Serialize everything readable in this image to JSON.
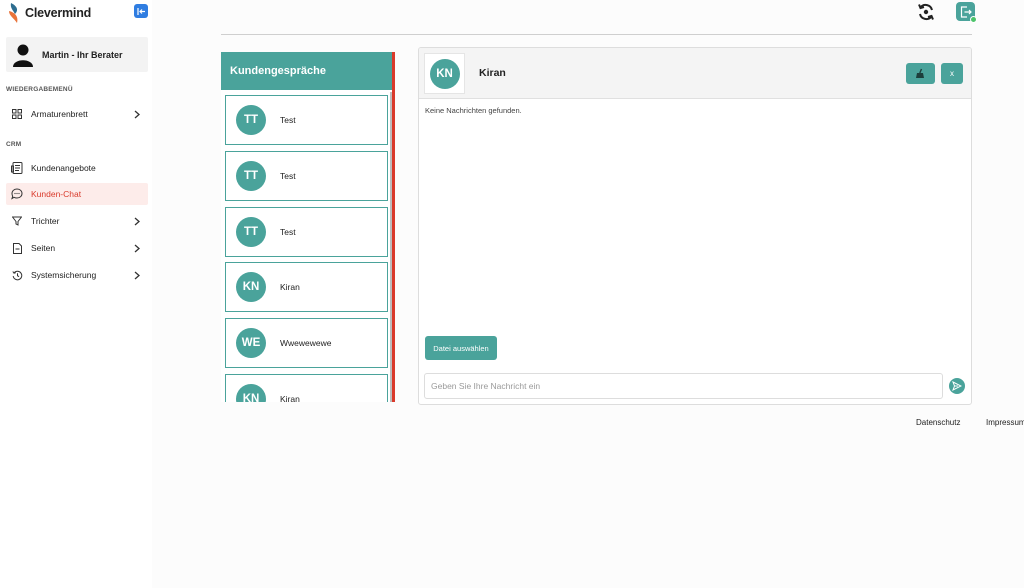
{
  "app": {
    "name": "Clevermind"
  },
  "user": {
    "name": "Martin - Ihr Berater"
  },
  "sidebar": {
    "section_main": "WIEDERGABEMENÜ",
    "dashboard": "Armaturenbrett",
    "section_crm": "CRM",
    "offers": "Kundenangebote",
    "chat": "Kunden-Chat",
    "funnel": "Trichter",
    "pages": "Seiten",
    "backup": "Systemsicherung"
  },
  "conversations": {
    "title": "Kundengespräche",
    "items": [
      {
        "initials": "TT",
        "name": "Test"
      },
      {
        "initials": "TT",
        "name": "Test"
      },
      {
        "initials": "TT",
        "name": "Test"
      },
      {
        "initials": "KN",
        "name": "Kiran"
      },
      {
        "initials": "WE",
        "name": "Wwewewewe"
      },
      {
        "initials": "KN",
        "name": "Kiran"
      }
    ]
  },
  "chat": {
    "initials": "KN",
    "name": "Kiran",
    "close_label": "x",
    "empty_text": "Keine Nachrichten gefunden.",
    "file_button": "Datei auswählen",
    "input_placeholder": "Geben Sie Ihre Nachricht ein"
  },
  "footer": {
    "privacy": "Datenschutz",
    "imprint": "Impressum"
  },
  "colors": {
    "accent": "#4aa39b",
    "active": "#d93a2b",
    "primary_button": "#2f7de1"
  }
}
